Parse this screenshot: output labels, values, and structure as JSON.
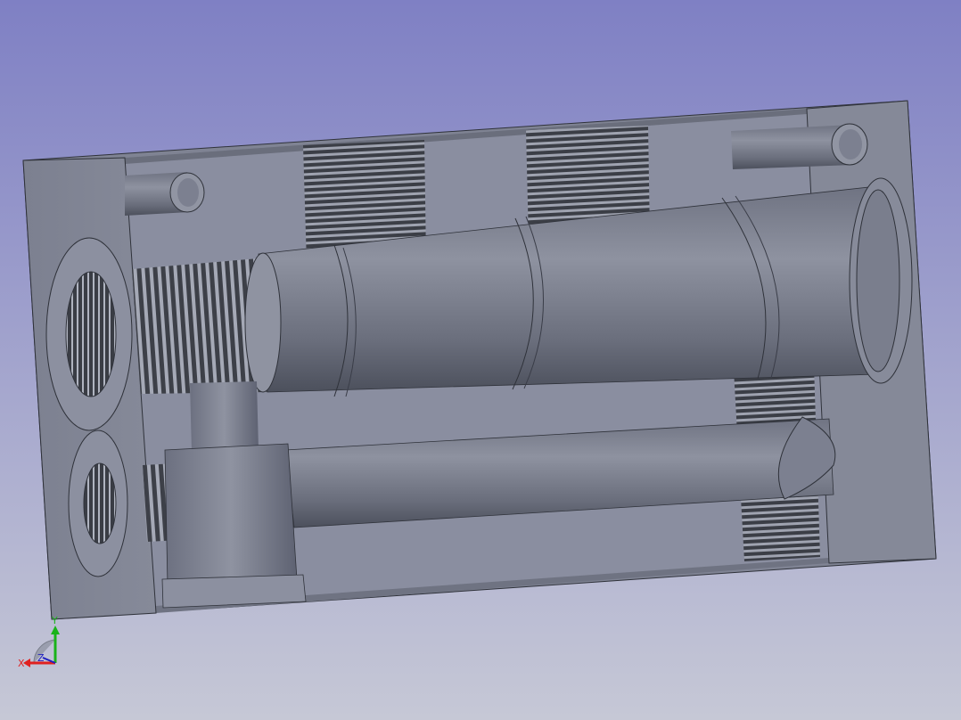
{
  "viewport": {
    "background_top": "#7f80c4",
    "background_bottom": "#c4c6d4"
  },
  "model": {
    "body_color": "#7f8393",
    "face_light": "#9a9eab",
    "face_dark": "#5d6170",
    "thread_dark": "#3b3e46",
    "thread_light": "#b4b8c4"
  },
  "axis_triad": {
    "x_label": "X",
    "y_label": "Y",
    "z_label": "Z",
    "x_color": "#e02020",
    "y_color": "#19b319",
    "z_color": "#2020c0"
  }
}
